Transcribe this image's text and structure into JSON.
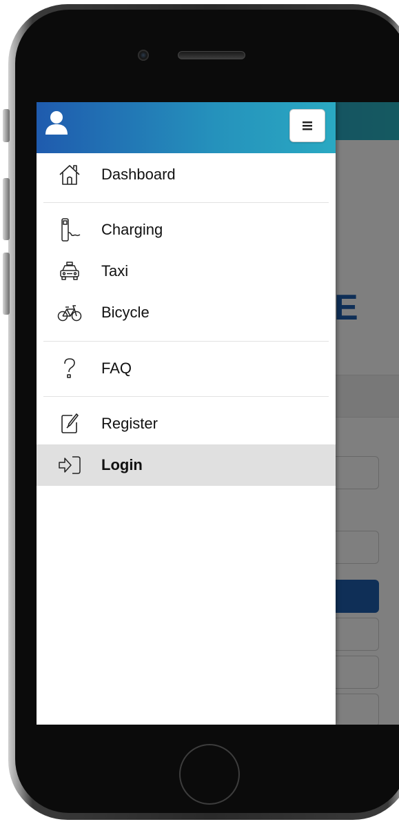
{
  "drawer": {
    "toggle_icon": "hamburger-icon",
    "user_icon": "user-icon",
    "items": [
      {
        "label": "Dashboard",
        "icon": "home-icon"
      },
      {
        "label": "Charging",
        "icon": "charging-station-icon"
      },
      {
        "label": "Taxi",
        "icon": "taxi-icon"
      },
      {
        "label": "Bicycle",
        "icon": "bicycle-icon"
      },
      {
        "label": "FAQ",
        "icon": "question-icon"
      },
      {
        "label": "Register",
        "icon": "edit-icon"
      },
      {
        "label": "Login",
        "icon": "login-icon",
        "active": true
      }
    ]
  },
  "background_page": {
    "heading_fragment": "E"
  },
  "colors": {
    "header_start": "#1f5bae",
    "header_end": "#2aa9c2",
    "active_row": "#e0e0e0",
    "primary_blue": "#1f5fae"
  }
}
